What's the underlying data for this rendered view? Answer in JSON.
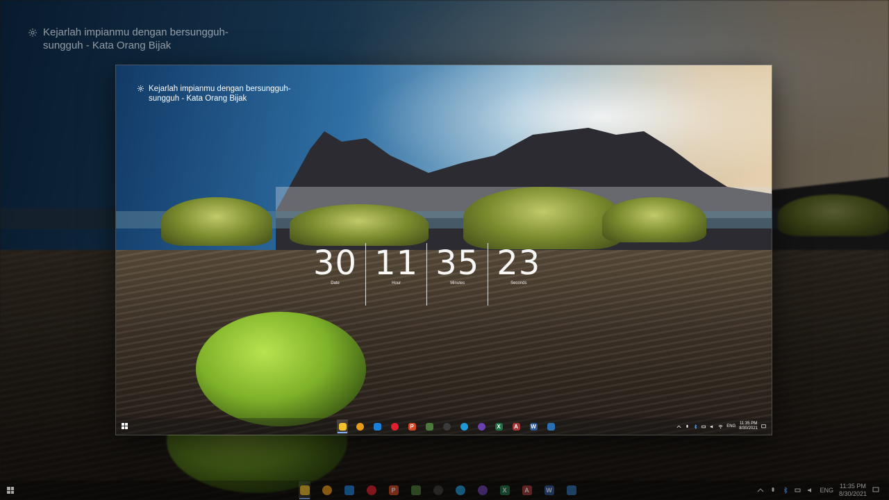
{
  "quote": {
    "line1": "Kejarlah impianmu dengan bersungguh-",
    "line2": "sungguh - Kata Orang Bijak"
  },
  "clock": {
    "date": {
      "value": "30",
      "label": "Date"
    },
    "hour": {
      "value": "11",
      "label": "Hour"
    },
    "minutes": {
      "value": "35",
      "label": "Minutes"
    },
    "seconds": {
      "value": "23",
      "label": "Seconds"
    }
  },
  "taskbar": {
    "apps": [
      {
        "name": "file-explorer",
        "color": "#f2c12e",
        "glyph": ""
      },
      {
        "name": "app-triangle",
        "color": "#e89a1a",
        "glyph": ""
      },
      {
        "name": "teamviewer",
        "color": "#1a7fd6",
        "glyph": ""
      },
      {
        "name": "opera",
        "color": "#e0202c",
        "glyph": ""
      },
      {
        "name": "powerpoint",
        "color": "#d24726",
        "glyph": "P"
      },
      {
        "name": "app-green",
        "color": "#4a7a3a",
        "glyph": ""
      },
      {
        "name": "obs",
        "color": "#3a3a3a",
        "glyph": ""
      },
      {
        "name": "edge",
        "color": "#1e9bd7",
        "glyph": ""
      },
      {
        "name": "app-purple",
        "color": "#6a3fb0",
        "glyph": ""
      },
      {
        "name": "excel",
        "color": "#1e7145",
        "glyph": "X"
      },
      {
        "name": "access",
        "color": "#a4373a",
        "glyph": "A"
      },
      {
        "name": "word",
        "color": "#2b579a",
        "glyph": "W"
      },
      {
        "name": "app-blue",
        "color": "#2a6fb0",
        "glyph": ""
      }
    ],
    "language": "ENG",
    "time": "11:35 PM",
    "date": "8/30/2021"
  },
  "colors": {
    "accent": "#8ab4ff",
    "text": "#ffffff"
  }
}
